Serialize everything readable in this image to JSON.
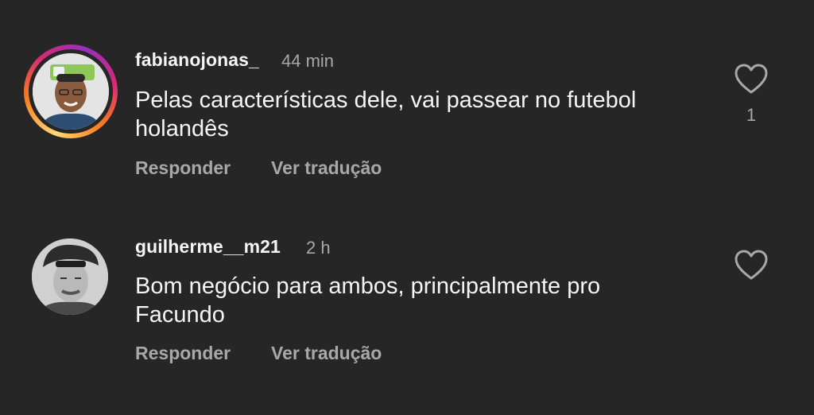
{
  "comments": [
    {
      "username": "fabianojonas_",
      "time": "44 min",
      "text_line1": "Pelas características dele, vai passear no futebol",
      "text_line2": "holandês",
      "reply_label": "Responder",
      "translate_label": "Ver tradução",
      "like_count": "1",
      "has_story_ring": true
    },
    {
      "username": "guilherme__m21",
      "time": "2 h",
      "text_line1": "Bom negócio para ambos, principalmente pro",
      "text_line2": "Facundo",
      "reply_label": "Responder",
      "translate_label": "Ver tradução",
      "like_count": "",
      "has_story_ring": false
    }
  ],
  "icons": {
    "like": "heart-outline-icon"
  },
  "colors": {
    "background": "#262626",
    "primary_text": "#f5f5f5",
    "secondary_text": "#a8a8a8"
  }
}
